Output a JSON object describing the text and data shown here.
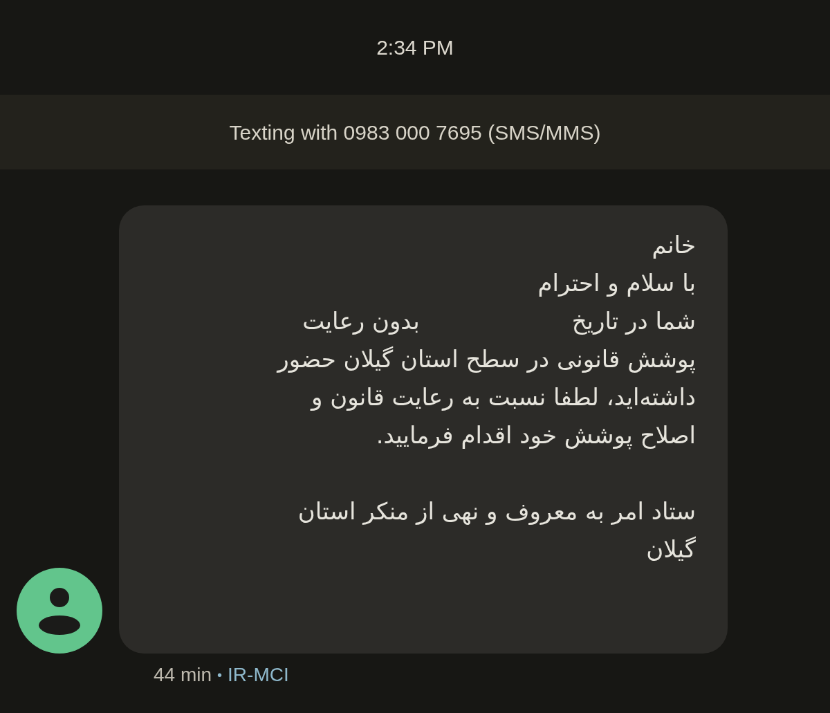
{
  "time": "2:34 PM",
  "banner": "Texting with 0983 000 7695 (SMS/MMS)",
  "message": {
    "lines": [
      {
        "parts": [
          "خانم"
        ]
      },
      {
        "parts": [
          "با سلام و احترام"
        ]
      },
      {
        "parts": [
          "شما در تاریخ",
          "بدون رعایت"
        ]
      },
      {
        "parts": [
          "پوشش قانونی در سطح استان گیلان حضور"
        ]
      },
      {
        "parts": [
          "داشته‌اید، لطفا نسبت به رعایت قانون و"
        ]
      },
      {
        "parts": [
          "اصلاح پوشش خود اقدام فرمایید."
        ]
      },
      {
        "kind": "blank"
      },
      {
        "parts": [
          "ستاد امر به معروف و نهی از منکر استان"
        ]
      },
      {
        "parts": [
          "گیلان"
        ]
      }
    ]
  },
  "footer": {
    "age": "44 min",
    "separator": "•",
    "carrier": "IR-MCI"
  }
}
